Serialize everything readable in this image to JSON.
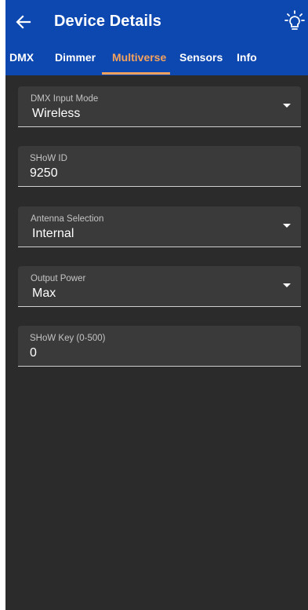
{
  "header": {
    "title": "Device Details",
    "back_icon": "arrow-left-icon",
    "action_icon": "lightbulb-icon",
    "background": "#0d47b0"
  },
  "tabs": [
    {
      "label": "DMX",
      "active": false
    },
    {
      "label": "Dimmer",
      "active": false
    },
    {
      "label": "Multiverse",
      "active": true
    },
    {
      "label": "Sensors",
      "active": false
    },
    {
      "label": "Info",
      "active": false
    }
  ],
  "accent_color": "#f5a25d",
  "fields": {
    "dmx_input_mode": {
      "label": "DMX Input Mode",
      "value": "Wireless"
    },
    "show_id": {
      "label": "SHoW ID",
      "value": "9250"
    },
    "antenna_selection": {
      "label": "Antenna Selection",
      "value": "Internal"
    },
    "output_power": {
      "label": "Output Power",
      "value": "Max"
    },
    "show_key": {
      "label": "SHoW Key (0-500)",
      "value": "0"
    }
  }
}
